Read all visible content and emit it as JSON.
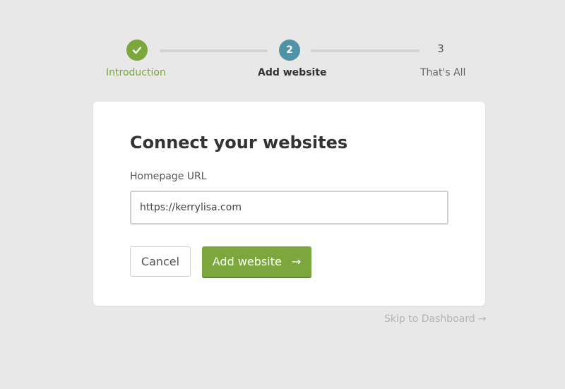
{
  "stepper": {
    "steps": [
      {
        "label": "Introduction",
        "state": "done",
        "icon": "check-icon"
      },
      {
        "label": "Add website",
        "number": "2",
        "state": "active"
      },
      {
        "label": "That's All",
        "number": "3",
        "state": "upcoming"
      }
    ]
  },
  "card": {
    "title": "Connect your websites",
    "url_label": "Homepage URL",
    "url_value": "https://kerrylisa.com",
    "cancel_label": "Cancel",
    "add_label": "Add website",
    "add_arrow_icon": "arrow-right-icon"
  },
  "skip": {
    "label": "Skip to Dashboard",
    "arrow_icon": "arrow-right-icon"
  },
  "colors": {
    "background": "#e8e8e8",
    "accent_green": "#7ba73c",
    "active_blue": "#4f93a8",
    "track_gray": "#d4d4d4"
  }
}
